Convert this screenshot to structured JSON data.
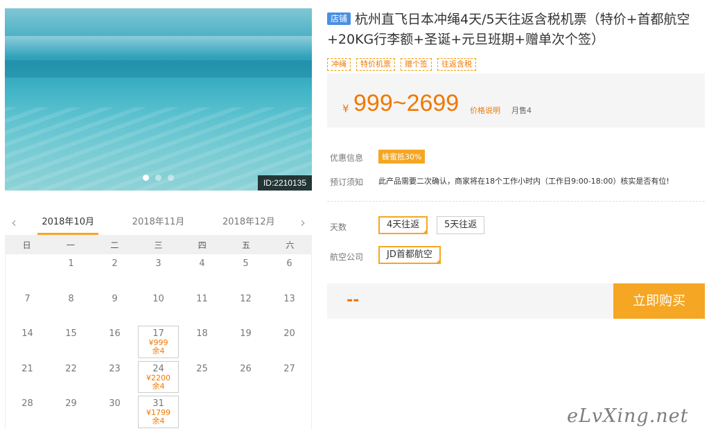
{
  "hero": {
    "id_label": "ID:2210135",
    "dots": 3
  },
  "calendar": {
    "months": [
      "2018年10月",
      "2018年11月",
      "2018年12月"
    ],
    "weekdays": [
      "日",
      "一",
      "二",
      "三",
      "四",
      "五",
      "六"
    ],
    "days": [
      [
        "",
        "1",
        "2",
        "3",
        "4",
        "5",
        "6"
      ],
      [
        "7",
        "8",
        "9",
        "10",
        "11",
        "12",
        "13"
      ],
      [
        "14",
        "15",
        "16",
        "17",
        "18",
        "19",
        "20"
      ],
      [
        "21",
        "22",
        "23",
        "24",
        "25",
        "26",
        "27"
      ],
      [
        "28",
        "29",
        "30",
        "31",
        "",
        "",
        ""
      ]
    ],
    "priced": {
      "17": {
        "price": "¥999",
        "stock": "余4"
      },
      "24": {
        "price": "¥2200",
        "stock": "余4"
      },
      "31": {
        "price": "¥1799",
        "stock": "余4"
      }
    }
  },
  "product": {
    "shop_badge": "店铺",
    "title": "杭州直飞日本冲绳4天/5天往返含税机票（特价+首都航空+20KG行李额+圣诞+元旦班期+赠单次个签）",
    "tags": [
      "冲绳",
      "特价机票",
      "赠个签",
      "往返含税"
    ],
    "currency": "¥",
    "price": "999~2699",
    "price_explain": "价格说明",
    "monthly_sales": "月售4",
    "promo_label": "优惠信息",
    "promo_badge": "蜂蜜抵30%",
    "notice_label": "预订须知",
    "notice_text": "此产品需要二次确认，商家将在18个工作小时内（工作日9:00-18:00）核实是否有位!",
    "days_label": "天数",
    "days_options": [
      "4天往返",
      "5天往返"
    ],
    "airline_label": "航空公司",
    "airline_options": [
      "JD首都航空"
    ],
    "selected_price": "--",
    "buy_label": "立即购买"
  },
  "watermark": "eLvXing.net",
  "colors": {
    "accent": "#f5a623",
    "price": "#f07800",
    "shop_badge": "#4a90e2"
  }
}
